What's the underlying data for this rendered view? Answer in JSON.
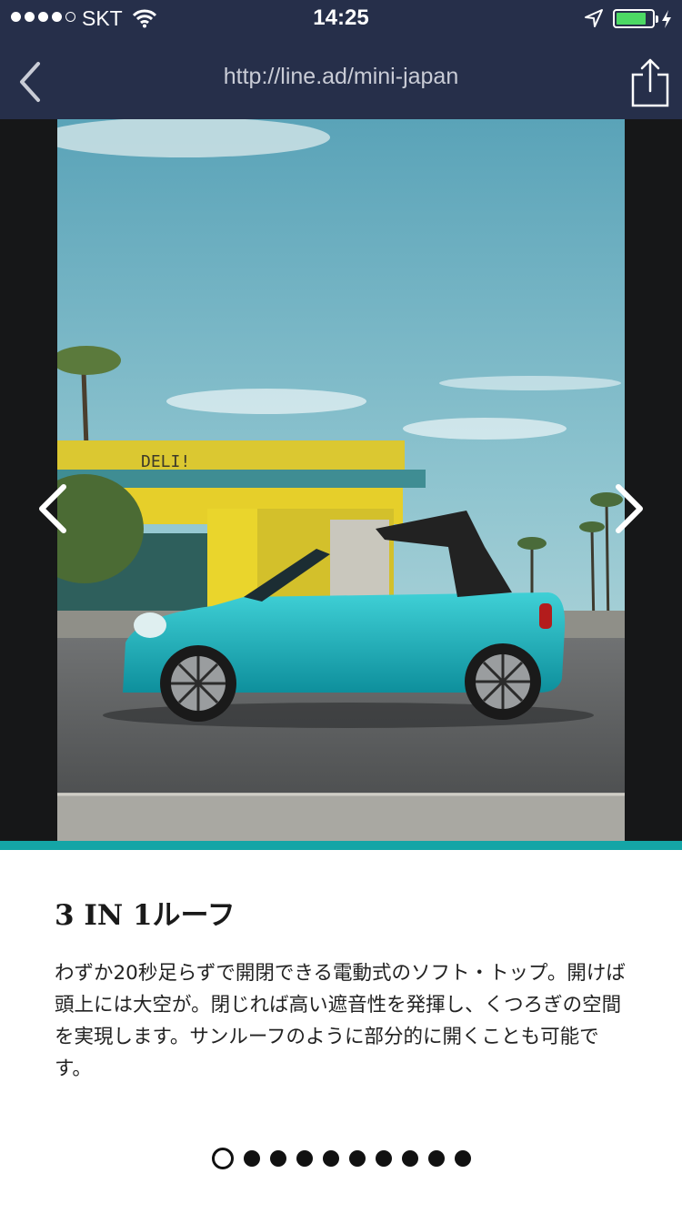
{
  "status_bar": {
    "carrier": "SKT",
    "time": "14:25",
    "signal_bars": 4,
    "signal_total": 5,
    "battery_level": 0.8,
    "battery_color": "#4cd964"
  },
  "nav": {
    "url": "http://line.ad/mini-japan",
    "back_icon": "chevron-left-icon",
    "share_icon": "share-icon",
    "background": "#262f4a"
  },
  "slide": {
    "sign_text": "DELI!",
    "title": "3 IN 1ルーフ",
    "description": "わずか20秒足らずで開閉できる電動式のソフト・トップ。開けば頭上には大空が。閉じれば高い遮音性を発揮し、くつろぎの空間を実現します。サンルーフのように部分的に開くことも可能です。",
    "accent_color": "#14a5a6"
  },
  "pager": {
    "total": 10,
    "current": 1
  }
}
